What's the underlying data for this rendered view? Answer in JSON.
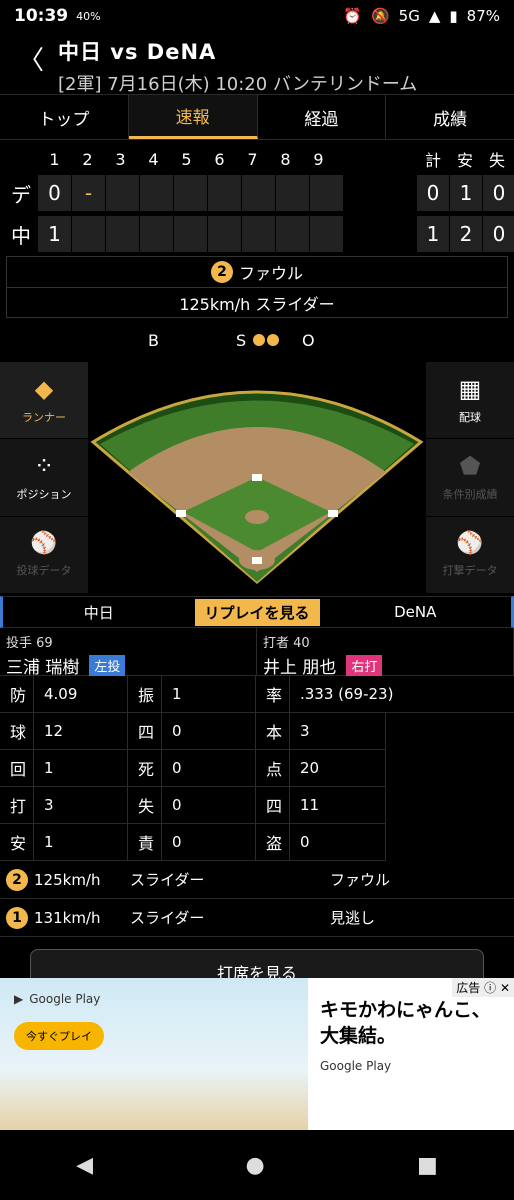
{
  "status": {
    "time": "10:39",
    "battery": "87%",
    "network": "5G",
    "small": "40%"
  },
  "header": {
    "title": "中日 vs DeNA",
    "subtitle": "[2軍] 7月16日(木) 10:20 バンテリンドーム"
  },
  "tabs": [
    "トップ",
    "速報",
    "経過",
    "成績"
  ],
  "scoreboard": {
    "innings": [
      "1",
      "2",
      "3",
      "4",
      "5",
      "6",
      "7",
      "8",
      "9"
    ],
    "total_labels": [
      "計",
      "安",
      "失"
    ],
    "rows": [
      {
        "team": "デ",
        "scores": [
          "0",
          "-",
          "",
          "",
          "",
          "",
          "",
          "",
          ""
        ],
        "totals": [
          "0",
          "1",
          "0"
        ]
      },
      {
        "team": "中",
        "scores": [
          "1",
          "",
          "",
          "",
          "",
          "",
          "",
          "",
          ""
        ],
        "totals": [
          "1",
          "2",
          "0"
        ]
      }
    ]
  },
  "play": {
    "num": "2",
    "result": "ファウル",
    "detail": "125km/h スライダー"
  },
  "bso": {
    "b": "B",
    "s": "S",
    "o": "O"
  },
  "side_left": [
    "ランナー",
    "ポジション",
    "投球データ"
  ],
  "side_right": [
    "配球",
    "条件別成績",
    "打撃データ"
  ],
  "teambar": {
    "home": "中日",
    "replay": "リプレイを見る",
    "away": "DeNA"
  },
  "pitcher": {
    "role": "投手 69",
    "name": "三浦 瑞樹",
    "hand": "左投"
  },
  "batter": {
    "role": "打者 40",
    "name": "井上 朋也",
    "hand": "右打"
  },
  "pitcher_stats": [
    [
      "防",
      "4.09"
    ],
    [
      "球",
      "12"
    ],
    [
      "回",
      "1"
    ],
    [
      "打",
      "3"
    ],
    [
      "安",
      "1"
    ]
  ],
  "pitcher_stats2": [
    [
      "振",
      "1"
    ],
    [
      "四",
      "0"
    ],
    [
      "死",
      "0"
    ],
    [
      "失",
      "0"
    ],
    [
      "責",
      "0"
    ]
  ],
  "batter_stats": [
    [
      "率",
      ".333 (69-23)"
    ],
    [
      "本",
      "3"
    ],
    [
      "点",
      "20"
    ],
    [
      "四",
      "11"
    ],
    [
      "盗",
      "0"
    ]
  ],
  "pitches": [
    {
      "num": "2",
      "speed": "125km/h",
      "type": "スライダー",
      "result": "ファウル"
    },
    {
      "num": "1",
      "speed": "131km/h",
      "type": "スライダー",
      "result": "見逃し"
    }
  ],
  "more_button": "打席を見る",
  "ad": {
    "tag": "広告",
    "headline1": "キモかわにゃんこ、",
    "headline2": "大集結。",
    "sub": "Google Play",
    "gp": "Google Play",
    "cta": "今すぐプレイ"
  },
  "nav": {
    "back": "◀",
    "home": "●",
    "recent": "■"
  },
  "colors": {
    "accent": "#f2b84b",
    "lefty": "#3a7bd5",
    "righty": "#e0357b"
  }
}
